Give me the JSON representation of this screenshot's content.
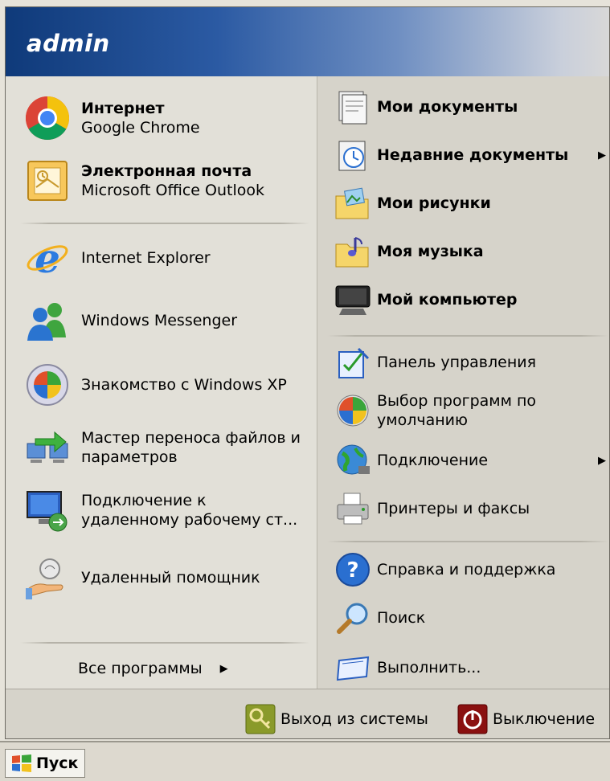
{
  "user": {
    "name": "admin"
  },
  "left": {
    "pinned": [
      {
        "main": "Интернет",
        "sub": "Google Chrome",
        "icon": "chrome-icon"
      },
      {
        "main": "Электронная почта",
        "sub": "Microsoft Office Outlook",
        "icon": "outlook-icon"
      }
    ],
    "recent": [
      {
        "label": "Internet Explorer",
        "icon": "ie-icon"
      },
      {
        "label": "Windows Messenger",
        "icon": "messenger-icon"
      },
      {
        "label": "Знакомство с Windows XP",
        "icon": "xp-tour-icon"
      },
      {
        "label": "Мастер переноса файлов и параметров",
        "line1": "Мастер переноса файлов и",
        "line2": "параметров",
        "icon": "transfer-wizard-icon"
      },
      {
        "label": "Подключение к удаленному рабочему ст...",
        "line1": "Подключение к",
        "line2": "удаленному рабочему ст...",
        "icon": "remote-desktop-icon"
      },
      {
        "label": "Удаленный помощник",
        "icon": "remote-assistance-icon"
      }
    ],
    "all_programs": "Все программы"
  },
  "right": {
    "top": [
      {
        "label": "Мои документы",
        "icon": "my-documents-icon"
      },
      {
        "label": "Недавние документы",
        "icon": "recent-documents-icon",
        "submenu": true
      },
      {
        "label": "Мои рисунки",
        "icon": "my-pictures-icon"
      },
      {
        "label": "Моя музыка",
        "icon": "my-music-icon"
      },
      {
        "label": "Мой компьютер",
        "icon": "my-computer-icon"
      }
    ],
    "middle": [
      {
        "label": "Панель управления",
        "icon": "control-panel-icon"
      },
      {
        "label": "Выбор программ по умолчанию",
        "line1": "Выбор программ по",
        "line2": "умолчанию",
        "icon": "default-programs-icon"
      },
      {
        "label": "Подключение",
        "icon": "connect-icon",
        "submenu": true
      },
      {
        "label": "Принтеры и факсы",
        "icon": "printers-icon"
      }
    ],
    "bottom": [
      {
        "label": "Справка и поддержка",
        "icon": "help-icon"
      },
      {
        "label": "Поиск",
        "icon": "search-icon"
      },
      {
        "label": "Выполнить...",
        "icon": "run-icon"
      }
    ]
  },
  "footer": {
    "logoff": "Выход из системы",
    "shutdown": "Выключение"
  },
  "taskbar": {
    "start": "Пуск"
  }
}
